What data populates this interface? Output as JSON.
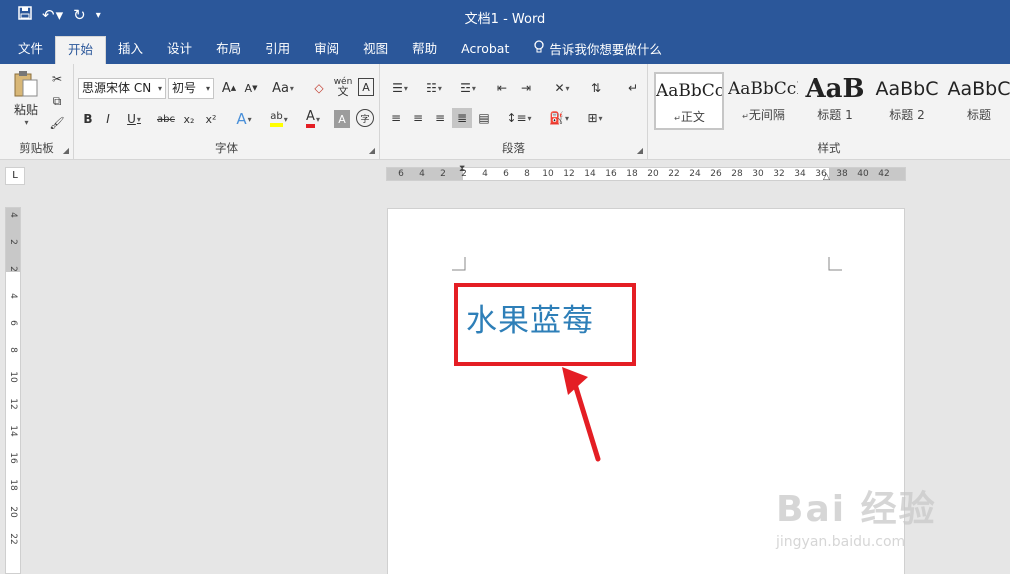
{
  "window": {
    "title": "文档1  -  Word",
    "qat": {
      "save_icon": "floppy-disk-icon",
      "undo_icon": "undo-icon",
      "redo_icon": "redo-icon",
      "customize_icon": "customize-qat-icon"
    }
  },
  "tabs": [
    "文件",
    "开始",
    "插入",
    "设计",
    "布局",
    "引用",
    "审阅",
    "视图",
    "帮助",
    "Acrobat"
  ],
  "active_tab": "开始",
  "tell_me": "告诉我你想要做什么",
  "ribbon": {
    "clipboard": {
      "label": "剪贴板",
      "paste": "粘贴"
    },
    "font": {
      "label": "字体",
      "font_name": "思源宋体 CN",
      "font_size": "初号",
      "grow": "A",
      "shrink": "A",
      "case": "Aa",
      "wen": "wén",
      "bold": "B",
      "italic": "I",
      "underline": "U",
      "strike": "abc",
      "sub": "x₂",
      "sup": "x²",
      "char_shading": "A",
      "enclose": "字"
    },
    "paragraph": {
      "label": "段落"
    },
    "styles": {
      "label": "样式",
      "items": [
        {
          "preview": "AaBbCcI",
          "name": "正文"
        },
        {
          "preview": "AaBbCcI",
          "name": "无间隔"
        },
        {
          "preview": "AaB",
          "name": "标题 1"
        },
        {
          "preview": "AaBbC",
          "name": "标题 2"
        },
        {
          "preview": "AaBbC",
          "name": "标题"
        }
      ]
    }
  },
  "ruler": {
    "h_ticks": [
      "6",
      "4",
      "2",
      "2",
      "4",
      "6",
      "8",
      "10",
      "12",
      "14",
      "16",
      "18",
      "20",
      "22",
      "24",
      "26",
      "28",
      "30",
      "32",
      "34",
      "36",
      "38",
      "40",
      "42"
    ],
    "v_ticks": [
      "4",
      "2",
      "2",
      "4",
      "6",
      "8",
      "10",
      "12",
      "14",
      "16",
      "18",
      "20",
      "22"
    ],
    "corner": "L"
  },
  "document": {
    "text": "水果蓝莓"
  },
  "watermark": {
    "logo": "Bai 经验",
    "url": "jingyan.baidu.com"
  },
  "colors": {
    "accent": "#2b579a",
    "highlight": "#e41e24",
    "text": "#2e7fb8"
  }
}
